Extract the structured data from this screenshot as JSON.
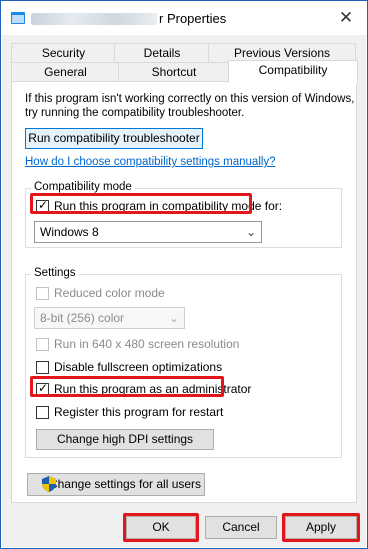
{
  "window": {
    "title_suffix": "r Properties",
    "close_glyph": "✕"
  },
  "tabs": {
    "row1": [
      "Security",
      "Details",
      "Previous Versions"
    ],
    "row2": [
      "General",
      "Shortcut",
      "Compatibility"
    ],
    "active": "Compatibility"
  },
  "intro": {
    "line1": "If this program isn't working correctly on this version of Windows,",
    "line2": "try running the compatibility troubleshooter."
  },
  "troubleshooter_button": "Run compatibility troubleshooter",
  "manual_link": "How do I choose compatibility settings manually?",
  "compat_mode": {
    "group_title": "Compatibility mode",
    "checkbox_label": "Run this program in compatibility mode for:",
    "checked": true,
    "selected_os": "Windows 8"
  },
  "settings": {
    "group_title": "Settings",
    "reduced_color": {
      "label": "Reduced color mode",
      "checked": false,
      "disabled": true
    },
    "color_select": "8-bit (256) color",
    "run_640": {
      "label": "Run in 640 x 480 screen resolution",
      "checked": false,
      "disabled": true
    },
    "fullscreen": {
      "label": "Disable fullscreen optimizations",
      "checked": false
    },
    "admin": {
      "label": "Run this program as an administrator",
      "checked": true
    },
    "restart": {
      "label": "Register this program for restart",
      "checked": false
    },
    "dpi_button": "Change high DPI settings"
  },
  "all_users_button": "Change settings for all users",
  "footer": {
    "ok": "OK",
    "cancel": "Cancel",
    "apply": "Apply"
  },
  "highlight_color": "#e3161b",
  "accent_color": "#0078d7",
  "link_color": "#0066cc"
}
